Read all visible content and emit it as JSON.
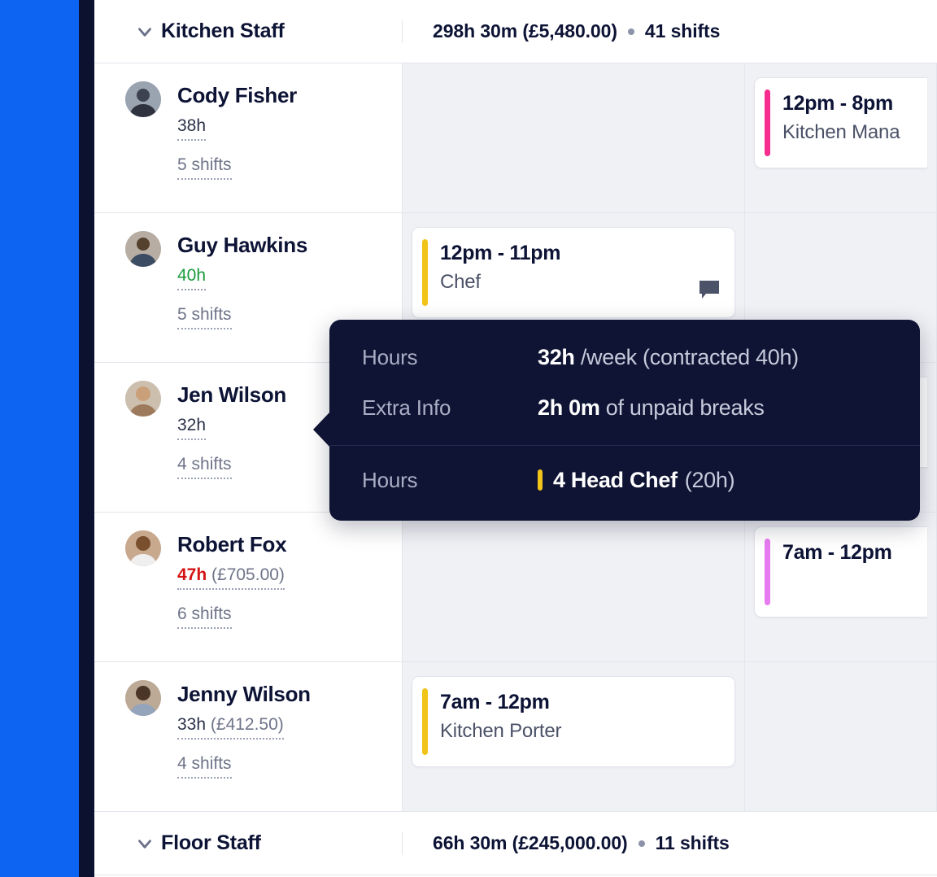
{
  "theme": {
    "rail_blue": "#0d64f2",
    "rail_dark": "#0d1130",
    "surface": "#ffffff",
    "lane_bg": "#f0f1f5",
    "text_dark": "#0d1335",
    "text_muted": "#6f7489",
    "ok_green": "#1a9b3c",
    "alert_red": "#d41313",
    "accent_yellow": "#f0c419",
    "accent_pink": "#f62c8e",
    "accent_violet": "#e77cf0",
    "tooltip_bg": "#0f1434"
  },
  "groups": [
    {
      "name": "Kitchen Staff",
      "summary_hours": "298h 30m (£5,480.00)",
      "summary_shifts": "41 shifts",
      "expanded": true
    },
    {
      "name": "Floor Staff",
      "summary_hours": "66h 30m (£245,000.00)",
      "summary_shifts": "11 shifts",
      "expanded": true
    }
  ],
  "employees": [
    {
      "name": "Cody Fisher",
      "hours": "38h",
      "hours_state": "dark",
      "cost": "",
      "shifts": "5 shifts",
      "lane1": null,
      "lane2": {
        "time": "12pm - 8pm",
        "role": "Kitchen Mana",
        "color": "pink",
        "has_note": false
      }
    },
    {
      "name": "Guy Hawkins",
      "hours": "40h",
      "hours_state": "green",
      "cost": "",
      "shifts": "5 shifts",
      "lane1": {
        "time": "12pm - 11pm",
        "role": "Chef",
        "color": "yellow",
        "has_note": true
      },
      "lane2": null
    },
    {
      "name": "Jen Wilson",
      "hours": "32h",
      "hours_state": "dark",
      "cost": "",
      "shifts": "4 shifts",
      "lane1": null,
      "lane2": null
    },
    {
      "name": "Robert Fox",
      "hours": "47h",
      "hours_state": "red",
      "cost": "(£705.00)",
      "shifts": "6 shifts",
      "lane1": null,
      "lane2": {
        "time": "7am - 12pm",
        "role": "",
        "color": "violet",
        "has_note": false
      }
    },
    {
      "name": "Jenny Wilson",
      "hours": "33h",
      "hours_state": "dark",
      "cost": "(£412.50)",
      "shifts": "4 shifts",
      "lane1": {
        "time": "7am - 12pm",
        "role": "Kitchen Porter",
        "color": "yellow",
        "has_note": false
      },
      "lane2": null
    }
  ],
  "tooltip": {
    "section_one": [
      {
        "label": "Hours",
        "value_strong": "32h",
        "value_muted": "/week (contracted 40h)"
      },
      {
        "label": "Extra Info",
        "value_strong": "2h 0m",
        "value_muted": "of unpaid breaks"
      }
    ],
    "section_two": {
      "label": "Hours",
      "swatch_color": "#f0c419",
      "role": "4 Head Chef",
      "role_hours": "(20h)"
    }
  },
  "icons": {
    "chevron": "chevron-down-icon",
    "note": "comment-icon",
    "dot": "separator-dot-icon"
  }
}
